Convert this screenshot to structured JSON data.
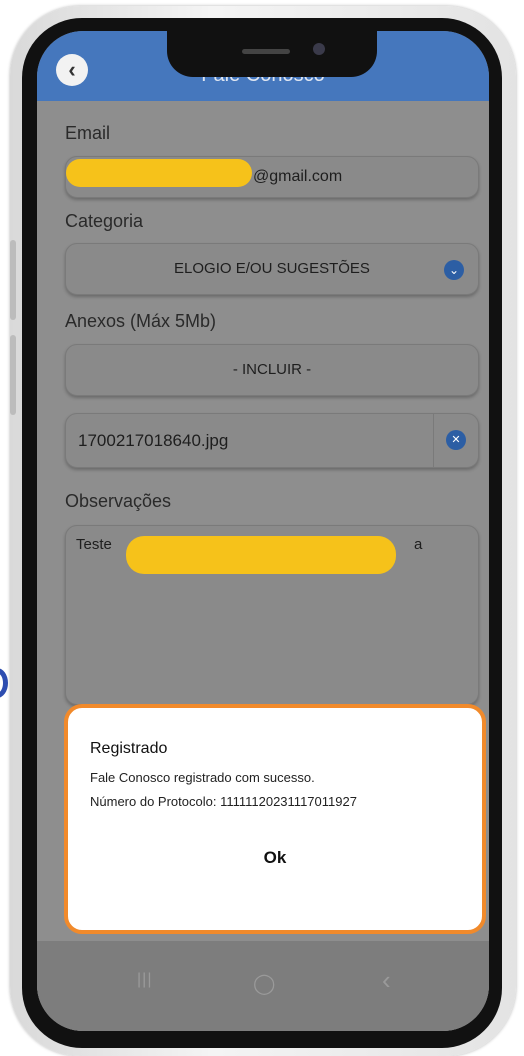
{
  "header": {
    "title": "Fale Conosco",
    "back_icon": "chevron-left-icon"
  },
  "form": {
    "email_label": "Email",
    "email_value": "@gmail.com",
    "category_label": "Categoria",
    "category_value": "ELOGIO E/OU SUGESTÕES",
    "attachments_label": "Anexos (Máx 5Mb)",
    "include_button": "- INCLUIR -",
    "attachment_file": "1700217018640.jpg",
    "observations_label": "Observações",
    "observations_start": "Teste",
    "observations_end": "a"
  },
  "dialog": {
    "title": "Registrado",
    "message": "Fale Conosco registrado com sucesso.",
    "protocol": "Número do Protocolo: 11111120231117011927",
    "ok_label": "Ok"
  },
  "nav": {
    "recent": "|||",
    "home": "◯",
    "back": "‹"
  },
  "colors": {
    "header": "#4577bd",
    "accent": "#2c5ea4",
    "highlight_border": "#f18a2b",
    "redaction": "#f6c21a"
  }
}
